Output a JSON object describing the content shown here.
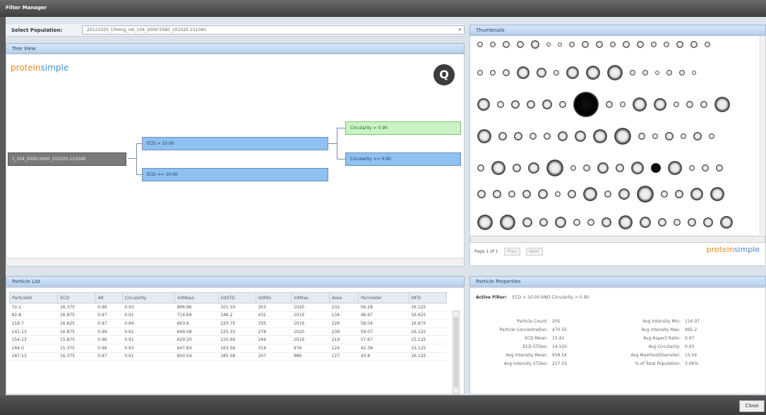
{
  "window": {
    "title": "Filter Manager"
  },
  "population": {
    "label": "Select Population:",
    "value": "20121020_15Hmg_mk_104_5000-5060_101020-151040"
  },
  "tree_view": {
    "header": "Tree View",
    "logo_left": "protein",
    "logo_right": "simple",
    "nodes": {
      "root": "t_104_5000-5060_101020-151040",
      "ecd_gt": "ECD > 10.00",
      "ecd_le": "ECD <= 10.00",
      "circ_gt": "Circularity > 0.90",
      "circ_le": "Circularity <= 0.90"
    }
  },
  "thumbnails": {
    "header": "Thumbnails",
    "page_label": "Page 1 of 1",
    "prev": "Prev",
    "next": "Next",
    "logo_left": "protein",
    "logo_right": "simple"
  },
  "particle_list": {
    "header": "Particle List",
    "columns": [
      "ParticleId",
      "ECD",
      "AR",
      "Circularity",
      "IntMean",
      "IntSTD",
      "IntMin",
      "IntMax",
      "Area",
      "Perimeter",
      "MFD"
    ],
    "rows": [
      [
        "72-1",
        "16.375",
        "0.96",
        "0.93",
        "896.96",
        "101.50",
        "353",
        "1020",
        "232",
        "56.28",
        "16.125"
      ],
      [
        "92-8",
        "16.875",
        "0.97",
        "0.91",
        "714.69",
        "146.2",
        "432",
        "1019",
        "134",
        "46.97",
        "16.625"
      ],
      [
        "118-7",
        "16.625",
        "0.97",
        "0.94",
        "663.6",
        "220.75",
        "335",
        "1019",
        "226",
        "58.04",
        "16.875"
      ],
      [
        "141-13",
        "16.875",
        "0.99",
        "0.91",
        "649.58",
        "225.33",
        "278",
        "1020",
        "239",
        "59.07",
        "16.125"
      ],
      [
        "154-13",
        "15.875",
        "0.96",
        "0.91",
        "629.20",
        "210.66",
        "244",
        "1019",
        "219",
        "57.67",
        "15.125"
      ],
      [
        "164-0",
        "15.375",
        "0.96",
        "0.93",
        "647.83",
        "163.56",
        "314",
        "976",
        "124",
        "42.38",
        "15.125"
      ],
      [
        "187-13",
        "16.375",
        "0.97",
        "0.91",
        "800.54",
        "185.58",
        "207",
        "986",
        "127",
        "43.8",
        "16.125"
      ]
    ]
  },
  "particle_properties": {
    "header": "Particle Properties",
    "active_filter_label": "Active Filter:",
    "active_filter_value": "ECD > 10.00 AND Circularity > 0.90",
    "left": [
      {
        "k": "Particle Count:",
        "v": "205"
      },
      {
        "k": "Particle Concentration:",
        "v": "470.55"
      },
      {
        "k": "ECD Mean:",
        "v": "15.42"
      },
      {
        "k": "ECD STDev:",
        "v": "14.150"
      },
      {
        "k": "Avg Intensity Mean:",
        "v": "958.54"
      },
      {
        "k": "Avg Intensity STDev:",
        "v": "227.53"
      }
    ],
    "right": [
      {
        "k": "Avg Intensity Min:",
        "v": "116.07"
      },
      {
        "k": "Avg Intensity Max:",
        "v": "995.2"
      },
      {
        "k": "Avg Aspect Ratio:",
        "v": "0.97"
      },
      {
        "k": "Avg Circularity:",
        "v": "0.93"
      },
      {
        "k": "Avg MaxFeretDiameter:",
        "v": "15.04"
      },
      {
        "k": "% of Total Population:",
        "v": "3.06%"
      }
    ]
  },
  "footer": {
    "close_label": "Close"
  }
}
